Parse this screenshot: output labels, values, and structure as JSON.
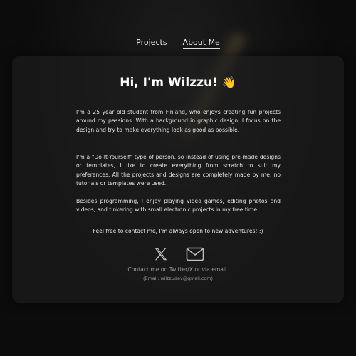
{
  "nav": {
    "projects": "Projects",
    "about": "About Me"
  },
  "main": {
    "title": "Hi, I'm Wilzzu!",
    "title_emoji": "👋",
    "paragraphs": [
      "I'm a 25 year old student from Finland, who enjoys creating fun projects around my passions. With a background in graphic design, I focus on the design and try to make everything look as good as possible.",
      "I'm a \"Do-It-Yourself\" type of person, so instead of using pre-made designs or templates, I like to create everything from scratch to suit my preferences. All the projects and designs are completely made by me, no tutorials or templates were used.",
      "Besides programming, I enjoy playing video games, editing photos and videos, and tinkering with small electronic projects in my free time."
    ],
    "contact_invite": "Feel free to contact me, I'm always open to new adventures! :)",
    "contact_note": "Contact me on Twitter/X or via email.",
    "email_note": "(Email: wilzzudev@gmail.com)"
  },
  "icons": {
    "twitter": "x-twitter-icon",
    "email": "mail-icon"
  },
  "colors": {
    "background": "#0c0c0c",
    "card": "#1e1e1e",
    "text": "#e4e4e4",
    "muted": "#9a9a9a"
  }
}
